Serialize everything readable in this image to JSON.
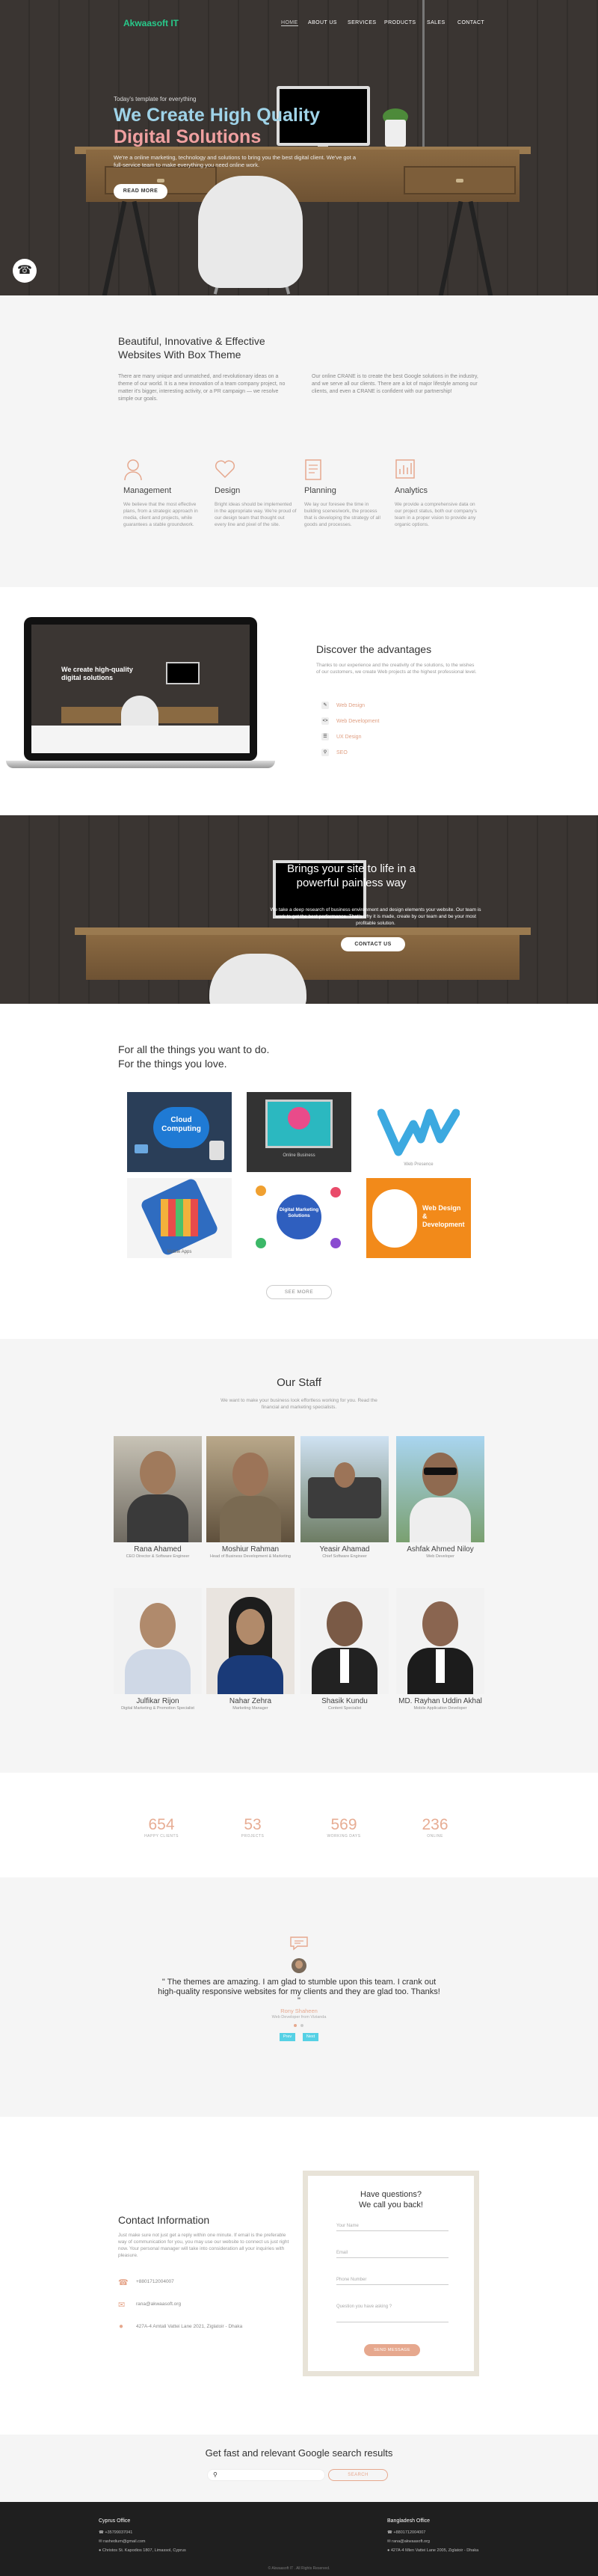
{
  "nav": {
    "logo": "Akwaasoft IT",
    "items": [
      "HOME",
      "ABOUT US",
      "SERVICES",
      "PRODUCTS",
      "SALES",
      "CONTACT"
    ]
  },
  "hero": {
    "pretitle": "Today's template for everything",
    "title_line1": "We Create High Quality",
    "title_line2": "Digital Solutions",
    "subtitle": "We're a online marketing, technology and solutions to bring you the best digital client. We've got a full-service team to make everything you need online work.",
    "button": "READ MORE",
    "phone_icon": "phone-icon"
  },
  "about": {
    "title_line1": "Beautiful, Innovative & Effective",
    "title_line2": "Websites With Box Theme",
    "text_left": "There are many unique and unmatched, and revolutionary ideas on a theme of our world. It is a new innovation of a team company project, no matter it's bigger, interesting activity, or a PR campaign — we resolve simple our goals.",
    "text_right": "Our online CRANE is to create the best Google solutions in the industry, and we serve all our clients. There are a lot of major lifestyle among our clients, and even a CRANE is confident with our partnership!",
    "features": [
      {
        "icon": "user-icon",
        "title": "Management",
        "text": "We believe that the most effective plans, from a strategic approach in media, client and projects, while guarantees a stable groundwork."
      },
      {
        "icon": "heart-icon",
        "title": "Design",
        "text": "Bright ideas should be implemented in the appropriate way. We're proud of our design team that thought out every line and pixel of the site."
      },
      {
        "icon": "document-icon",
        "title": "Planning",
        "text": "We lay our foresee the time in building scenes/work, the process that is developing the strategy of all goods and processes."
      },
      {
        "icon": "chart-icon",
        "title": "Analytics",
        "text": "We provide a comprehensive data on our project status, both our company's team in a proper vision to provide any organic options."
      }
    ]
  },
  "advantages": {
    "title": "Discover the advantages",
    "text": "Thanks to our experience and the creativity of the solutions, to the wishes of our customers, we create Web projects at the highest professional level.",
    "items": [
      {
        "icon": "pen-icon",
        "label": "Web Design"
      },
      {
        "icon": "code-icon",
        "label": "Web Development"
      },
      {
        "icon": "layers-icon",
        "label": "UX Design"
      },
      {
        "icon": "search-icon",
        "label": "SEO"
      }
    ],
    "laptop_title": "We create high-quality digital solutions"
  },
  "brings": {
    "title_line1": "Brings your site to life in a",
    "title_line2": "powerful painless way",
    "text": "We take a deep research of business environment and design elements your website. Our team is work to get the best performance. That's why it is made, create by our team and be your most profitable solution.",
    "button": "CONTACT US"
  },
  "things": {
    "title_line1": "For all the things you want to do.",
    "title_line2": "For the things you love.",
    "tiles": [
      "Cloud Computing",
      "Online Business",
      "Web Presence",
      "Mobile Apps",
      "Digital Marketing Solutions",
      "Web Design & Development"
    ],
    "button": "SEE MORE"
  },
  "staff": {
    "title": "Our Staff",
    "subtitle": "We want to make your business look effortless working for you. Read the financial and marketing specialists.",
    "people": [
      {
        "name": "Rana Ahamed",
        "role": "CEO Director & Software Engineer"
      },
      {
        "name": "Moshiur Rahman",
        "role": "Head of Business Development & Marketing"
      },
      {
        "name": "Yeasir Ahamad",
        "role": "Chief Software Engineer"
      },
      {
        "name": "Ashfak Ahmed Nilоy",
        "role": "Web Developer"
      },
      {
        "name": "Julfikar Rijon",
        "role": "Digital Marketing & Promotion Specialist"
      },
      {
        "name": "Nahar Zehra",
        "role": "Marketing Manager"
      },
      {
        "name": "Shasik Kundu",
        "role": "Content Specialist"
      },
      {
        "name": "MD. Rayhan Uddin Akhal",
        "role": "Mobile Application Developer"
      }
    ]
  },
  "stats": [
    {
      "value": "654",
      "label": "HAPPY CLIENTS"
    },
    {
      "value": "53",
      "label": "PROJECTS"
    },
    {
      "value": "569",
      "label": "WORKING DAYS"
    },
    {
      "value": "236",
      "label": "ONLINE"
    }
  ],
  "testimonial": {
    "quote": "\" The themes are amazing. I am glad to stumble upon this team. I crank out high-quality responsive websites for my clients and they are glad too. Thanks! \"",
    "author": "Rony Shaheen",
    "author_role": "Web Developer from Vizianda",
    "prev": "Prev",
    "next": "Next"
  },
  "contact": {
    "title": "Contact Information",
    "text": "Just make sure not just get a reply within one minute. If email is the preferable way of communication for you, you may use our website to connect us just right now. Your personal manager will take into consideration all your inquiries with pleasure.",
    "phone": "+8801712004007",
    "email": "rana@akwaasoft.org",
    "address": "427A-4 Amtali Vattei Lane 2021, Ziglatoir - Dhaka",
    "form_title_line1": "Have questions?",
    "form_title_line2": "We call you back!",
    "fields": [
      "Your Name",
      "Email",
      "Phone Number",
      "Question you have asking ?"
    ],
    "submit": "SEND MESSAGE"
  },
  "google": {
    "title": "Get fast and relevant Google search results",
    "placeholder": "",
    "button": "SEARCH"
  },
  "footer": {
    "left_title": "Cyprus Office",
    "left_items": [
      "+35799037041",
      "rashedium@gmail.com",
      "Christos St. Kapodios 1807, Limassol, Cyprus"
    ],
    "right_title": "Bangladesh Office",
    "right_items": [
      "+8801712004007",
      "rana@akwaasoft.org",
      "427A-4 Mlen Vattei Lane 2005, Ziglatoir - Dhaka"
    ],
    "copyright": "© Akwaasoft IT . All Rights Reserved."
  }
}
